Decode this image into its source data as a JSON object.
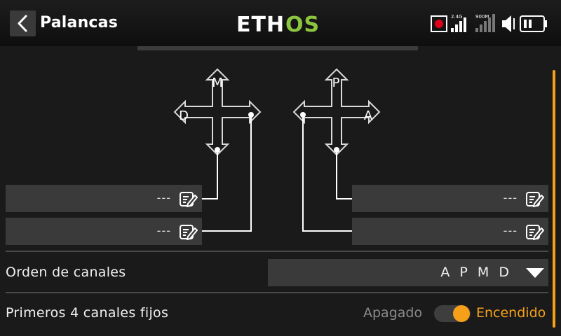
{
  "header": {
    "title": "Palancas",
    "logo_text_left": "ETH",
    "logo_text_right": "OS",
    "signal_24_label": "2.4G",
    "signal_900_label": "900M"
  },
  "sticks": {
    "left": {
      "up": "M",
      "left": "D"
    },
    "right": {
      "up": "P",
      "right": "A"
    }
  },
  "channel_fields": {
    "left_top": "---",
    "left_bottom": "---",
    "right_top": "---",
    "right_bottom": "---"
  },
  "channel_order": {
    "label": "Orden de canales",
    "value": "A P M D"
  },
  "first_four_fixed": {
    "label": "Primeros 4 canales fijos",
    "off_label": "Apagado",
    "on_label": "Encendido",
    "state": "on"
  },
  "colors": {
    "accent": "#f6a01a",
    "logo_green": "#8cc63f",
    "record": "#e0001a"
  }
}
